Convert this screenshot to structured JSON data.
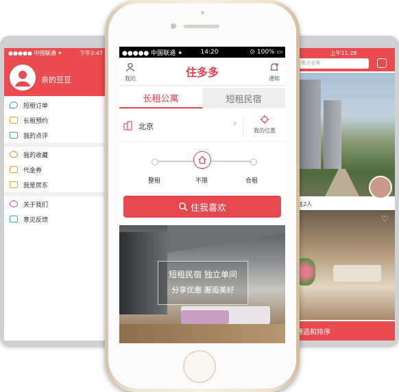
{
  "left_phone": {
    "status": {
      "carrier": "●●●●● 中国联通 ✦",
      "time": "下午3:47"
    },
    "username": "亲的豆豆",
    "menu": [
      {
        "label": "短租订单",
        "color": "#3a8ee6",
        "icon": "location-icon"
      },
      {
        "label": "长租预约",
        "color": "#f0a21e",
        "icon": "calendar-icon"
      },
      {
        "label": "我的点评",
        "color": "#3fb06c",
        "icon": "comment-icon"
      },
      {
        "label": "我的收藏",
        "color": "#f07a2c",
        "icon": "heart-icon"
      },
      {
        "label": "代金券",
        "color": "#f0a21e",
        "icon": "coupon-icon"
      },
      {
        "label": "我是房东",
        "color": "#f0a21e",
        "icon": "landlord-icon"
      },
      {
        "label": "关于我们",
        "color": "#d63fa6",
        "icon": "about-icon"
      },
      {
        "label": "意见反馈",
        "color": "#2bb0a7",
        "icon": "feedback-icon"
      }
    ]
  },
  "main_phone": {
    "status": {
      "carrier": "●●●●● 中国联通 ✦",
      "time": "14:20",
      "battery": "100%"
    },
    "nav": {
      "left_label": "我的",
      "title": "住多多",
      "right_label": "通知"
    },
    "tabs": [
      {
        "label": "长租公寓"
      },
      {
        "label": "短租民宿"
      }
    ],
    "city": "北京",
    "my_location": "我的位置",
    "slider": {
      "options": [
        "整租",
        "不限",
        "合租"
      ],
      "selected_index": 1
    },
    "search_button": "住我喜欢",
    "banner": {
      "line1": "短租民宿 独立单间",
      "line2": "分享优惠 邂逅美好"
    }
  },
  "right_phone": {
    "status": {
      "time": "上午11:28"
    },
    "search_placeholder": "地/景点名等",
    "listing_caption": "适住2人",
    "bottom_bar": "筛选和排序"
  }
}
